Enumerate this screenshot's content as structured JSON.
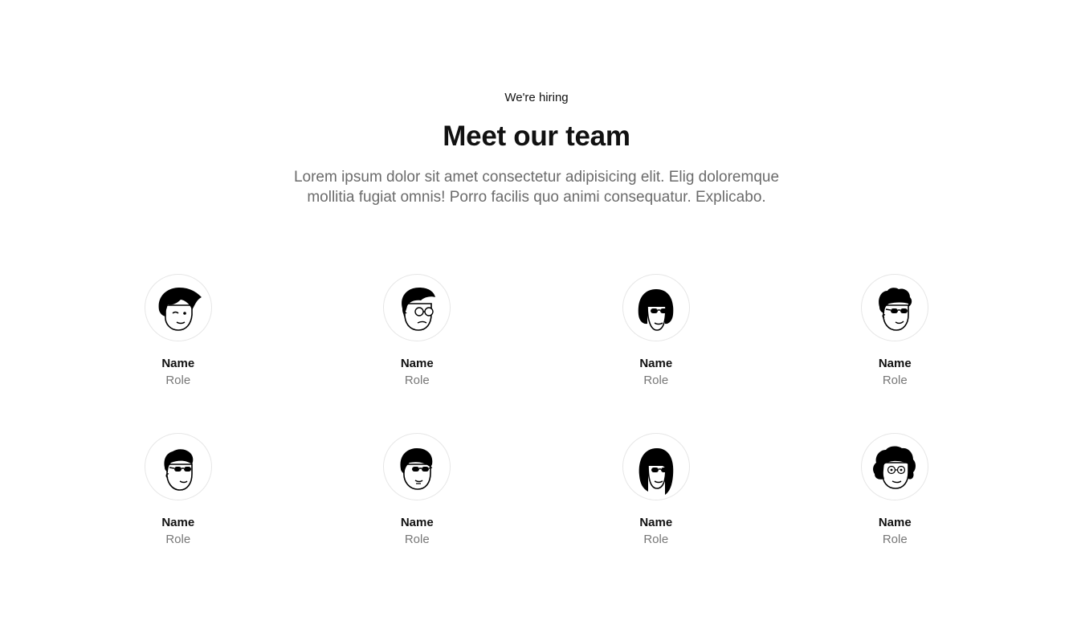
{
  "header": {
    "eyebrow": "We're hiring",
    "title": "Meet our team",
    "subtitle": "Lorem ipsum dolor sit amet consectetur adipisicing elit. Elig doloremque mollitia fugiat omnis! Porro facilis quo animi consequatur. Explicabo."
  },
  "team": [
    {
      "name": "Name",
      "role": "Role",
      "avatar": "avatar-wavy-hair-icon"
    },
    {
      "name": "Name",
      "role": "Role",
      "avatar": "avatar-round-glasses-icon"
    },
    {
      "name": "Name",
      "role": "Role",
      "avatar": "avatar-bob-sunglasses-icon"
    },
    {
      "name": "Name",
      "role": "Role",
      "avatar": "avatar-curly-sunglasses-icon"
    },
    {
      "name": "Name",
      "role": "Role",
      "avatar": "avatar-quiff-sunglasses-icon"
    },
    {
      "name": "Name",
      "role": "Role",
      "avatar": "avatar-bowl-sunglasses-icon"
    },
    {
      "name": "Name",
      "role": "Role",
      "avatar": "avatar-long-hair-sunglasses-icon"
    },
    {
      "name": "Name",
      "role": "Role",
      "avatar": "avatar-curly-glasses-icon"
    }
  ],
  "colors": {
    "text": "#111111",
    "muted": "#6b6b6b",
    "role": "#777777",
    "avatar_border": "#e6e6e6"
  }
}
